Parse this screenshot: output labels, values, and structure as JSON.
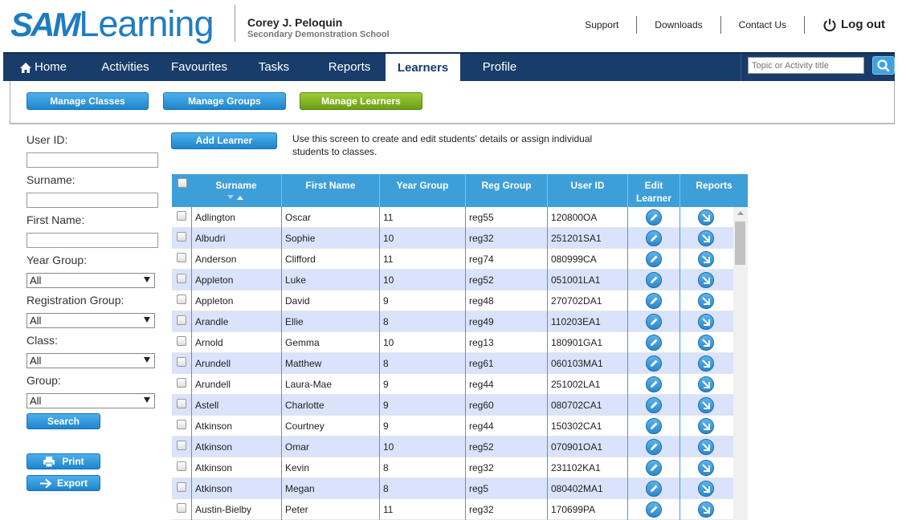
{
  "brand": {
    "logo_part1": "SAM",
    "logo_part2": "Learning"
  },
  "user": {
    "name": "Corey J. Peloquin",
    "school": "Secondary Demonstration School"
  },
  "top_links": {
    "support": "Support",
    "downloads": "Downloads",
    "contact": "Contact Us",
    "logout": "Log out"
  },
  "nav": {
    "home": "Home",
    "activities": "Activities",
    "favourites": "Favourites",
    "tasks": "Tasks",
    "reports": "Reports",
    "learners": "Learners",
    "profile": "Profile",
    "search_placeholder": "Topic or Activity title"
  },
  "subtabs": {
    "manage_classes": "Manage Classes",
    "manage_groups": "Manage Groups",
    "manage_learners": "Manage Learners"
  },
  "filters": {
    "user_id_label": "User ID:",
    "surname_label": "Surname:",
    "first_name_label": "First Name:",
    "year_group_label": "Year Group:",
    "year_group_value": "All",
    "reg_group_label": "Registration Group:",
    "reg_group_value": "All",
    "class_label": "Class:",
    "class_value": "All",
    "group_label": "Group:",
    "group_value": "All",
    "search_button": "Search",
    "print_button": "Print",
    "export_button": "Export"
  },
  "main": {
    "add_learner_button": "Add Learner",
    "help_text": "Use this screen to create and edit students' details or assign individual students to classes."
  },
  "table": {
    "headers": {
      "surname": "Surname",
      "first_name": "First Name",
      "year_group": "Year Group",
      "reg_group": "Reg Group",
      "user_id": "User ID",
      "edit_learner": "Edit Learner",
      "reports": "Reports"
    },
    "rows": [
      {
        "surname": "Adlington",
        "first": "Oscar",
        "year": "11",
        "reg": "reg55",
        "uid": "120800OA"
      },
      {
        "surname": "Albudri",
        "first": "Sophie",
        "year": "10",
        "reg": "reg32",
        "uid": "251201SA1"
      },
      {
        "surname": "Anderson",
        "first": "Clifford",
        "year": "11",
        "reg": "reg74",
        "uid": "080999CA"
      },
      {
        "surname": "Appleton",
        "first": "Luke",
        "year": "10",
        "reg": "reg52",
        "uid": "051001LA1"
      },
      {
        "surname": "Appleton",
        "first": "David",
        "year": "9",
        "reg": "reg48",
        "uid": "270702DA1"
      },
      {
        "surname": "Arandle",
        "first": "Ellie",
        "year": "8",
        "reg": "reg49",
        "uid": "110203EA1"
      },
      {
        "surname": "Arnold",
        "first": "Gemma",
        "year": "10",
        "reg": "reg13",
        "uid": "180901GA1"
      },
      {
        "surname": "Arundell",
        "first": "Matthew",
        "year": "8",
        "reg": "reg61",
        "uid": "060103MA1"
      },
      {
        "surname": "Arundell",
        "first": "Laura-Mae",
        "year": "9",
        "reg": "reg44",
        "uid": "251002LA1"
      },
      {
        "surname": "Astell",
        "first": "Charlotte",
        "year": "9",
        "reg": "reg60",
        "uid": "080702CA1"
      },
      {
        "surname": "Atkinson",
        "first": "Courtney",
        "year": "9",
        "reg": "reg44",
        "uid": "150302CA1"
      },
      {
        "surname": "Atkinson",
        "first": "Omar",
        "year": "10",
        "reg": "reg52",
        "uid": "070901OA1"
      },
      {
        "surname": "Atkinson",
        "first": "Kevin",
        "year": "8",
        "reg": "reg32",
        "uid": "231102KA1"
      },
      {
        "surname": "Atkinson",
        "first": "Megan",
        "year": "8",
        "reg": "reg5",
        "uid": "080402MA1"
      },
      {
        "surname": "Austin-Bielby",
        "first": "Peter",
        "year": "11",
        "reg": "reg32",
        "uid": "170699PA"
      }
    ]
  },
  "colors": {
    "brand_blue": "#1f7cc1",
    "nav_bg": "#183d6a",
    "table_header": "#3e9fd8",
    "row_alt": "#d9e3fb",
    "active_tab_green": "#7fb324"
  }
}
